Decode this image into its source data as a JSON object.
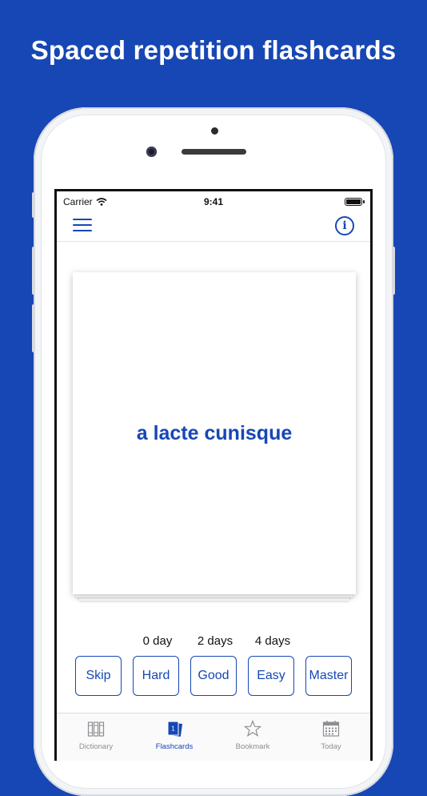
{
  "headline": "Spaced repetition flashcards",
  "status_bar": {
    "carrier": "Carrier",
    "time": "9:41"
  },
  "card": {
    "word": "a lacte cunisque"
  },
  "intervals": [
    "0 day",
    "2 days",
    "4 days"
  ],
  "buttons": [
    "Skip",
    "Hard",
    "Good",
    "Easy",
    "Master"
  ],
  "tabs": [
    {
      "label": "Dictionary",
      "icon": "books-icon"
    },
    {
      "label": "Flashcards",
      "icon": "flashcards-icon",
      "badge": "1",
      "active": true
    },
    {
      "label": "Bookmark",
      "icon": "star-icon"
    },
    {
      "label": "Today",
      "icon": "calendar-icon"
    }
  ],
  "colors": {
    "brand": "#1747b4",
    "inactive": "#8e8e93"
  }
}
